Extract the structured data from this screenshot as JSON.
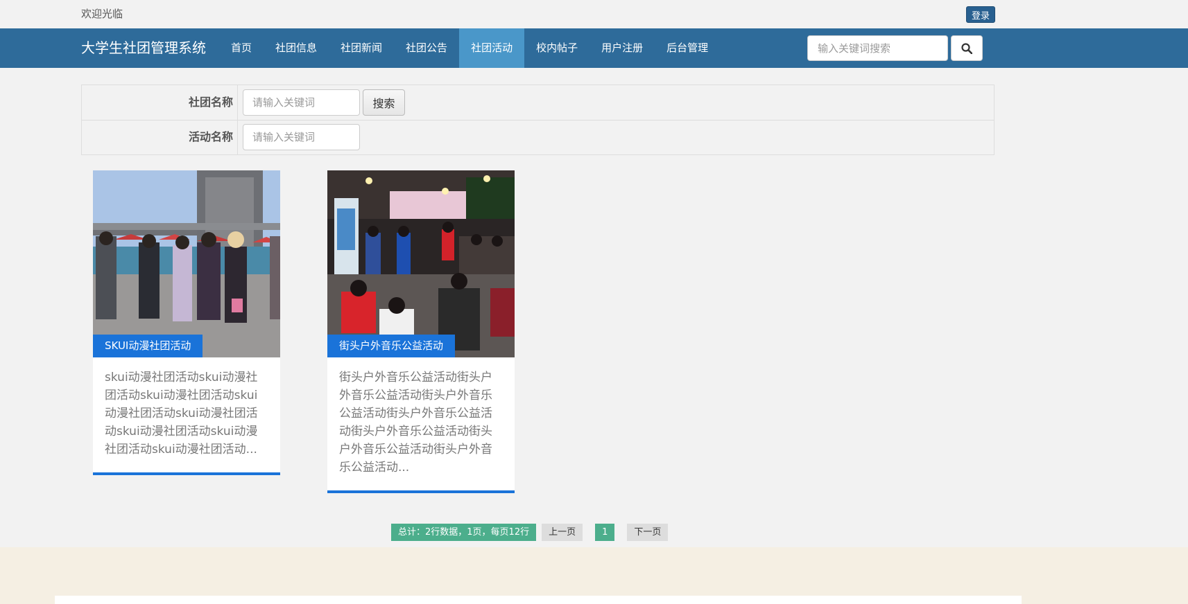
{
  "topbar": {
    "welcome": "欢迎光临",
    "login": "登录"
  },
  "navbar": {
    "brand": "大学生社团管理系统",
    "items": [
      "首页",
      "社团信息",
      "社团新闻",
      "社团公告",
      "社团活动",
      "校内帖子",
      "用户注册",
      "后台管理"
    ],
    "active_index": 4,
    "search_placeholder": "输入关键词搜索",
    "search_icon": "search-icon"
  },
  "filter": {
    "club_label": "社团名称",
    "club_placeholder": "请输入关键词",
    "search_button": "搜索",
    "activity_label": "活动名称",
    "activity_placeholder": "请输入关键词"
  },
  "activities": [
    {
      "title": "SKUI动漫社团活动",
      "description": "skui动漫社团活动skui动漫社团活动skui动漫社团活动skui动漫社团活动skui动漫社团活动skui动漫社团活动skui动漫社团活动skui动漫社团活动..."
    },
    {
      "title": "街头户外音乐公益活动",
      "description": "街头户外音乐公益活动街头户外音乐公益活动街头户外音乐公益活动街头户外音乐公益活动街头户外音乐公益活动街头户外音乐公益活动街头户外音乐公益活动..."
    }
  ],
  "pager": {
    "total": "总计：2行数据，1页，每页12行",
    "prev": "上一页",
    "current": "1",
    "next": "下一页"
  },
  "colors": {
    "nav": "#2e6b9a",
    "nav_active": "#4a97c9",
    "accent": "#1a73d9",
    "pager": "#4cae8c"
  }
}
